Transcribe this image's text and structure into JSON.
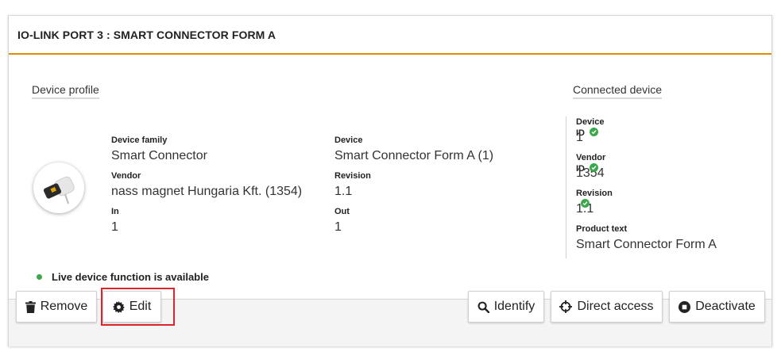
{
  "header": {
    "title": "IO-LINK PORT 3 : SMART CONNECTOR FORM A"
  },
  "device_profile": {
    "section_label": "Device profile",
    "device_family_label": "Device family",
    "device_family": "Smart Connector",
    "vendor_label": "Vendor",
    "vendor": "nass magnet Hungaria Kft. (1354)",
    "in_label": "In",
    "in": "1",
    "device_label": "Device",
    "device": "Smart Connector Form A (1)",
    "revision_label": "Revision",
    "revision": "1.1",
    "out_label": "Out",
    "out": "1"
  },
  "connected_device": {
    "section_label": "Connected device",
    "device_id_label": "Device ID",
    "device_id": "1",
    "vendor_id_label": "Vendor ID",
    "vendor_id": "1354",
    "revision_label": "Revision",
    "revision": "1.1",
    "product_text_label": "Product text",
    "product_text": "Smart Connector Form A"
  },
  "status": {
    "live_text": "Live device function is available",
    "color": "#3aa84b"
  },
  "buttons": {
    "remove": "Remove",
    "edit": "Edit",
    "identify": "Identify",
    "direct_access": "Direct access",
    "deactivate": "Deactivate"
  },
  "icons": {
    "remove": "trash-icon",
    "edit": "gear-icon",
    "identify": "search-icon",
    "direct_access": "crosshair-icon",
    "deactivate": "stop-circle-icon",
    "verified": "check-circle-icon"
  },
  "colors": {
    "accent": "#e08a00",
    "highlight": "#d9252b",
    "ok": "#3aa84b"
  }
}
